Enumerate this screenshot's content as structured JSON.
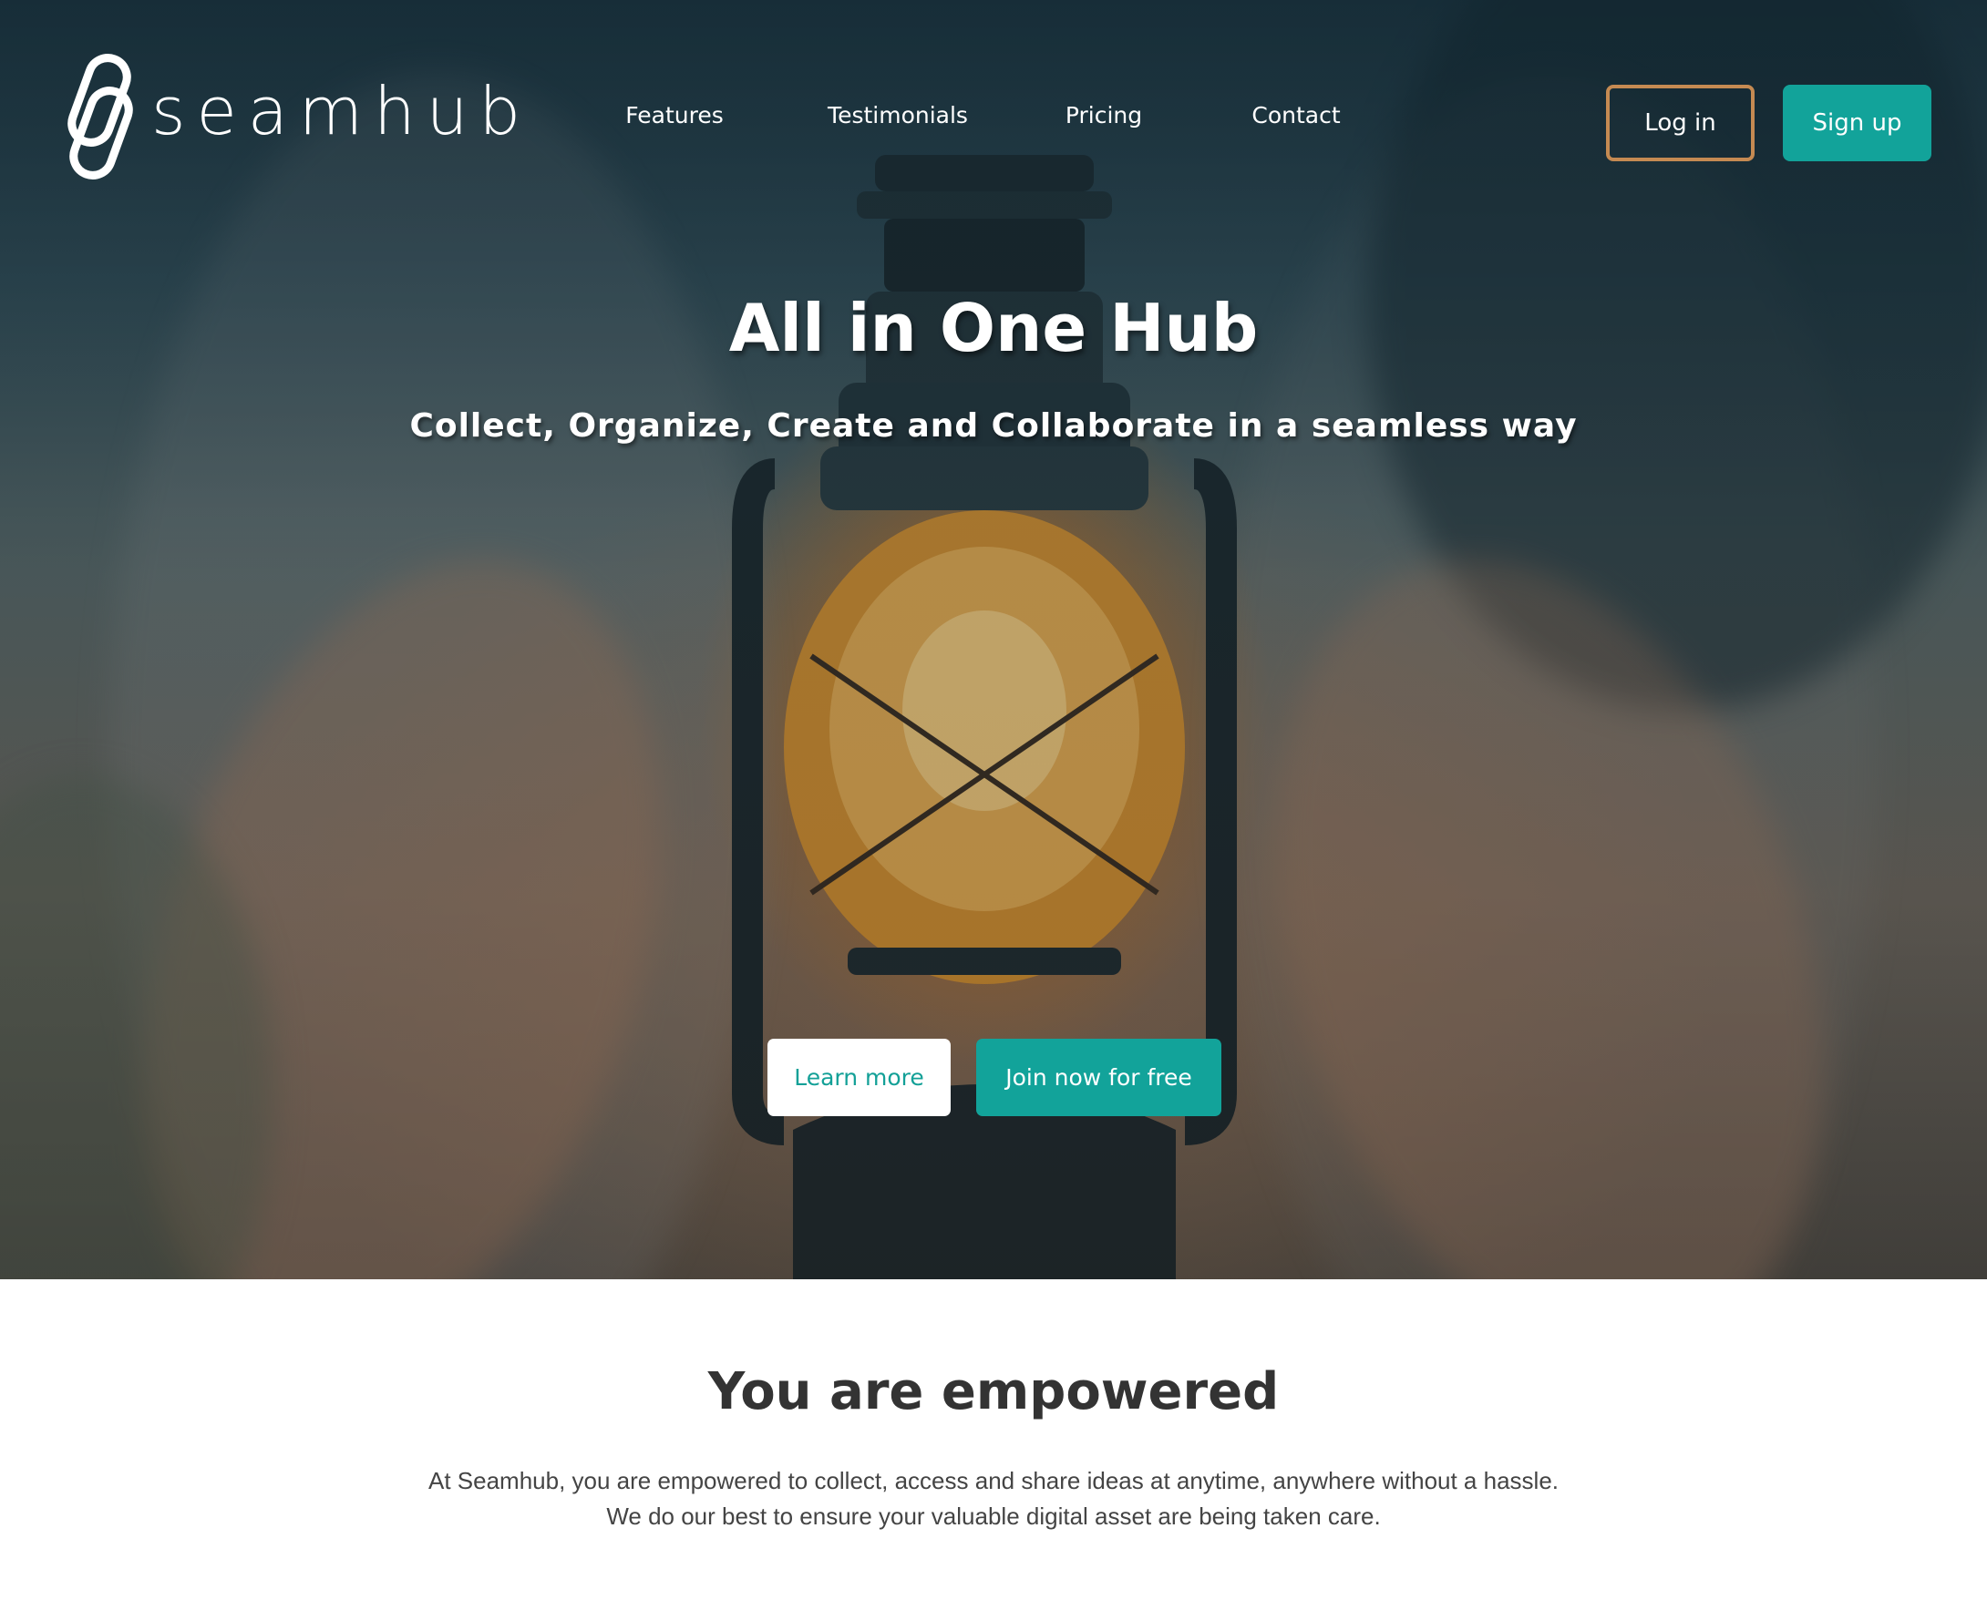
{
  "brand": {
    "name": "seamhub",
    "accent_color": "#12a39a",
    "login_border_color": "#c58a52"
  },
  "nav": {
    "items": [
      {
        "label": "Features"
      },
      {
        "label": "Testimonials"
      },
      {
        "label": "Pricing"
      },
      {
        "label": "Contact"
      }
    ],
    "login_label": "Log in",
    "signup_label": "Sign up"
  },
  "hero": {
    "title": "All in One Hub",
    "subtitle": "Collect, Organize, Create and Collaborate in a seamless way",
    "learn_more_label": "Learn more",
    "join_label": "Join now for free"
  },
  "about": {
    "title": "You are empowered",
    "line1": "At Seamhub, you are empowered to collect, access and share ideas at anytime, anywhere without a hassle.",
    "line2": "We do our best to ensure your valuable digital asset are being taken care."
  }
}
